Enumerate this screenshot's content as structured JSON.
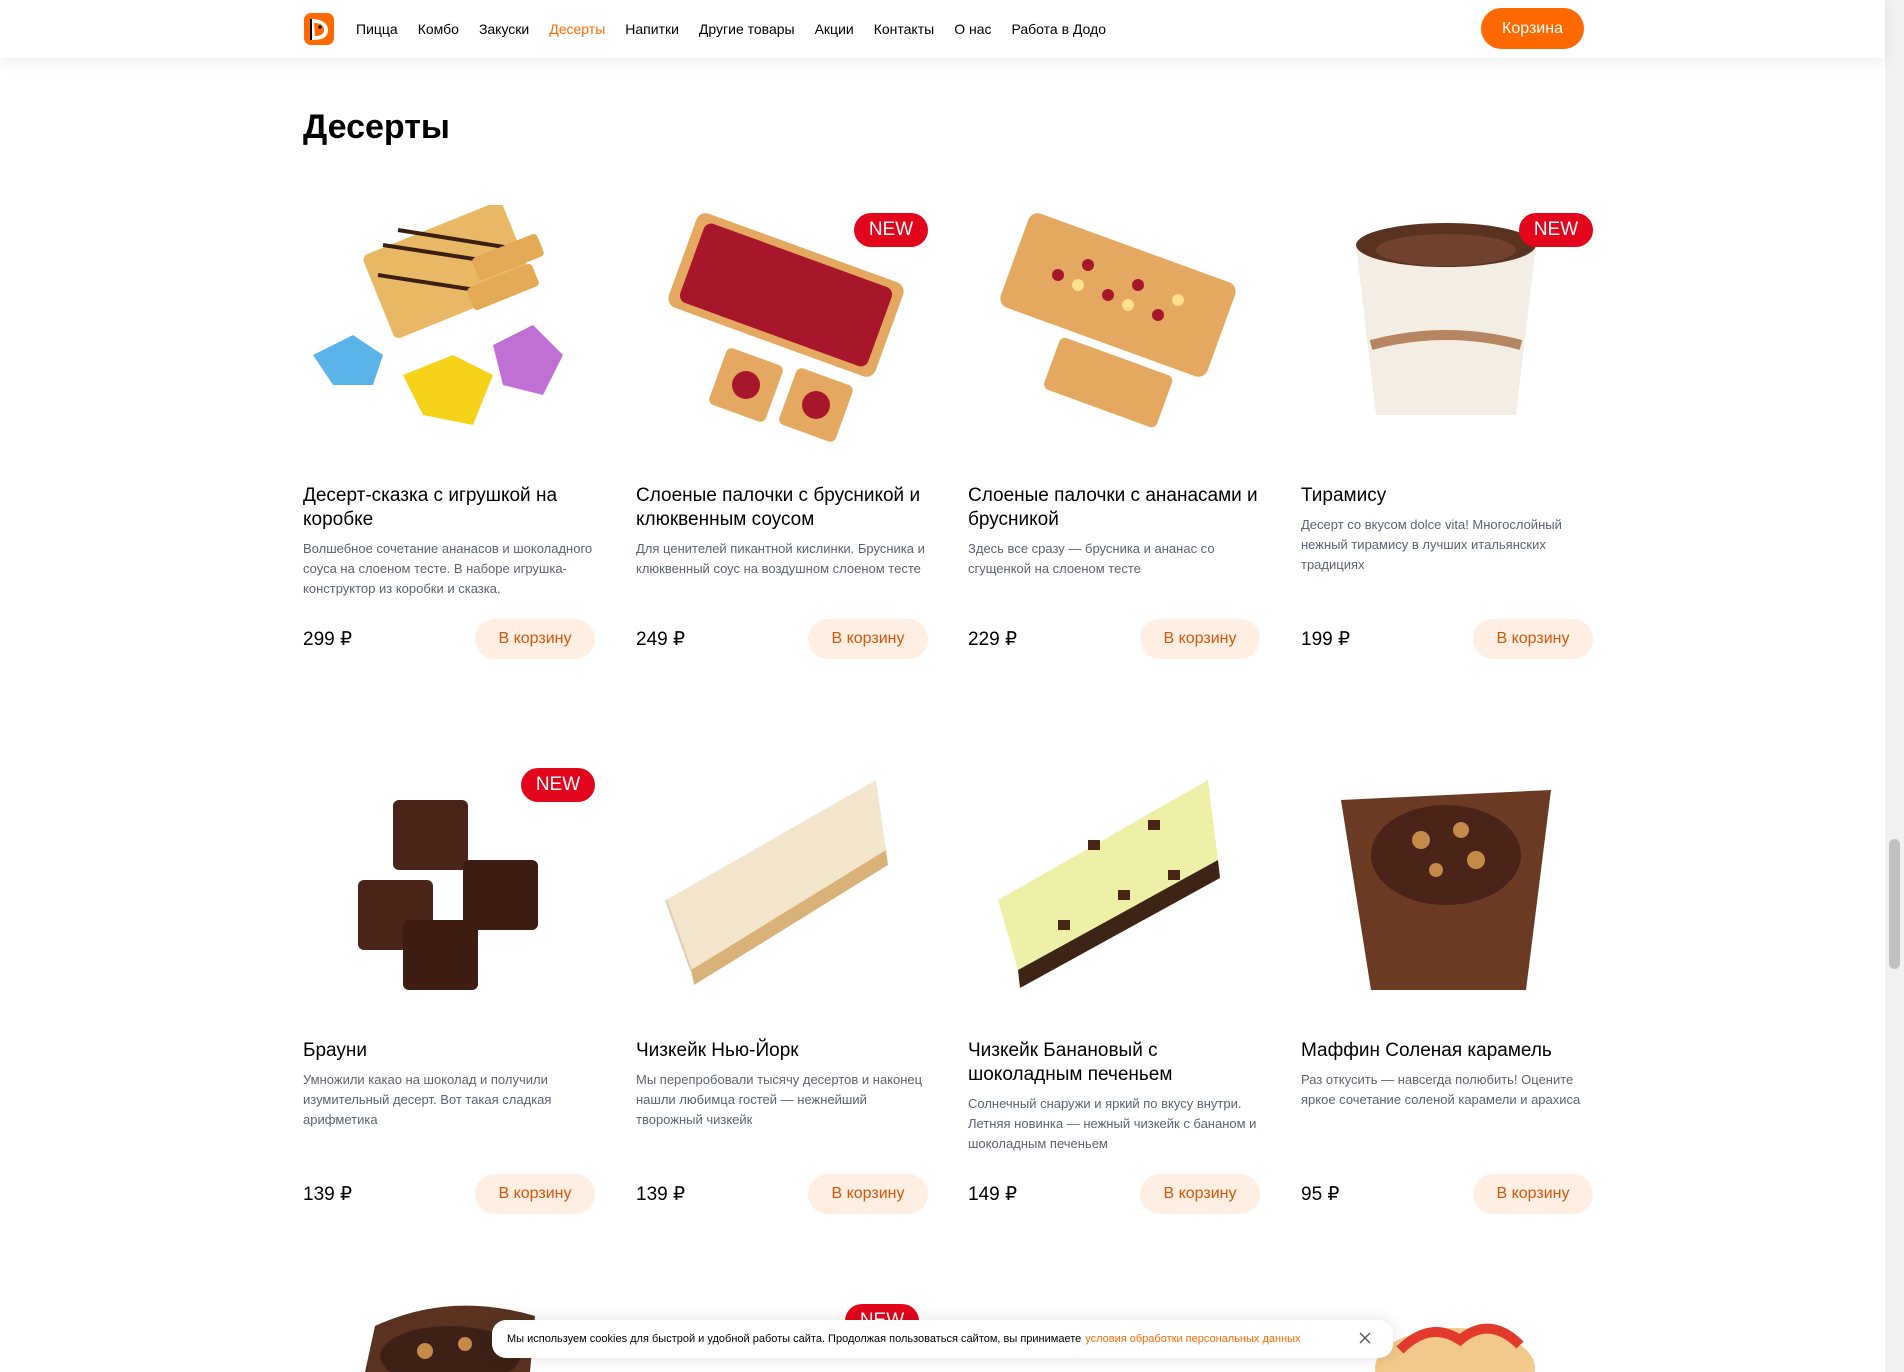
{
  "header": {
    "nav": [
      "Пицца",
      "Комбо",
      "Закуски",
      "Десерты",
      "Напитки",
      "Другие товары",
      "Акции",
      "Контакты",
      "О нас",
      "Работа в Додо"
    ],
    "active_index": 3,
    "cart_label": "Корзина"
  },
  "section": {
    "title": "Десерты"
  },
  "badge_label": "NEW",
  "add_label": "В корзину",
  "products": [
    {
      "name": "Десерт-сказка с игрушкой на коробке",
      "description": "Волшебное сочетание ананасов и шоколадного соуса на слоеном тесте. В наборе игрушка-конструктор из коробки и сказка.",
      "price": "299 ₽",
      "is_new": false,
      "image": "puff-chocolate-dino-toys"
    },
    {
      "name": "Слоеные палочки с брусникой и клюквенным соусом",
      "description": "Для ценителей пикантной кислинки. Брусника и клюквенный соус на воздушном слоеном тесте",
      "price": "249 ₽",
      "is_new": true,
      "image": "puff-berry-sticks"
    },
    {
      "name": "Слоеные палочки с ананасами и брусникой",
      "description": "Здесь все сразу — брусника и ананас со сгущенкой на слоеном тесте",
      "price": "229 ₽",
      "is_new": false,
      "image": "puff-pineapple-berry-sticks"
    },
    {
      "name": "Тирамису",
      "description": "Десерт со вкусом dolce vita! Многослойный нежный тирамису в лучших итальянских традициях",
      "price": "199 ₽",
      "is_new": true,
      "image": "tiramisu-cup"
    },
    {
      "name": "Брауни",
      "description": "Умножили какао на шоколад и получили изумительный десерт. Вот такая сладкая арифметика",
      "price": "139 ₽",
      "is_new": true,
      "image": "brownie-cubes"
    },
    {
      "name": "Чизкейк Нью-Йорк",
      "description": "Мы перепробовали тысячу десертов и наконец нашли любимца гостей — нежнейший творожный чизкейк",
      "price": "139 ₽",
      "is_new": false,
      "image": "cheesecake-slice"
    },
    {
      "name": "Чизкейк Банановый с шоколадным печеньем",
      "description": "Солнечный снаружи и яркий по вкусу внутри. Летняя новинка — нежный чизкейк с бананом и шоколадным печеньем",
      "price": "149 ₽",
      "is_new": false,
      "image": "banana-cheesecake-slice"
    },
    {
      "name": "Маффин Соленая карамель",
      "description": "Раз откусить — навсегда полюбить! Оцените яркое сочетание соленой карамели и арахиса",
      "price": "95 ₽",
      "is_new": false,
      "image": "caramel-muffin"
    }
  ],
  "cookie": {
    "text": "Мы используем cookies для быстрой и удобной работы сайта. Продолжая пользоваться сайтом, вы принимаете",
    "link": "условия обработки персональных данных"
  },
  "colors": {
    "accent": "#ff6900",
    "badge": "#e3051b",
    "button_bg": "#ffeee2",
    "button_text": "#d1570d",
    "muted": "#5c6370"
  },
  "icons": [
    "dodo-logo-icon",
    "close-icon"
  ]
}
